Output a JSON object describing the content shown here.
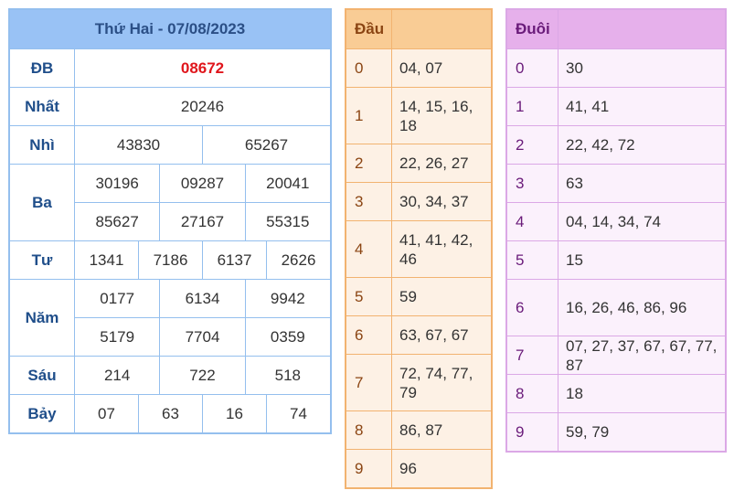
{
  "results": {
    "title": "Thứ Hai - 07/08/2023",
    "prizes": [
      {
        "label": "ĐB",
        "lines": [
          [
            "08672"
          ]
        ]
      },
      {
        "label": "Nhất",
        "lines": [
          [
            "20246"
          ]
        ]
      },
      {
        "label": "Nhì",
        "lines": [
          [
            "43830",
            "65267"
          ]
        ]
      },
      {
        "label": "Ba",
        "lines": [
          [
            "30196",
            "09287",
            "20041"
          ],
          [
            "85627",
            "27167",
            "55315"
          ]
        ]
      },
      {
        "label": "Tư",
        "lines": [
          [
            "1341",
            "7186",
            "6137",
            "2626"
          ]
        ]
      },
      {
        "label": "Năm",
        "lines": [
          [
            "0177",
            "6134",
            "9942"
          ],
          [
            "5179",
            "7704",
            "0359"
          ]
        ]
      },
      {
        "label": "Sáu",
        "lines": [
          [
            "214",
            "722",
            "518"
          ]
        ]
      },
      {
        "label": "Bảy",
        "lines": [
          [
            "07",
            "63",
            "16",
            "74"
          ]
        ]
      }
    ]
  },
  "dau": {
    "header": "Đầu",
    "rows": [
      {
        "key": "0",
        "values": "04, 07"
      },
      {
        "key": "1",
        "values": "14, 15, 16, 18"
      },
      {
        "key": "2",
        "values": "22, 26, 27"
      },
      {
        "key": "3",
        "values": "30, 34, 37"
      },
      {
        "key": "4",
        "values": "41, 41, 42, 46"
      },
      {
        "key": "5",
        "values": "59"
      },
      {
        "key": "6",
        "values": "63, 67, 67"
      },
      {
        "key": "7",
        "values": "72, 74, 77, 79"
      },
      {
        "key": "8",
        "values": "86, 87"
      },
      {
        "key": "9",
        "values": "96"
      }
    ]
  },
  "duoi": {
    "header": "Đuôi",
    "rows": [
      {
        "key": "0",
        "values": "30"
      },
      {
        "key": "1",
        "values": "41, 41"
      },
      {
        "key": "2",
        "values": "22, 42, 72"
      },
      {
        "key": "3",
        "values": "63"
      },
      {
        "key": "4",
        "values": "04, 14, 34, 74"
      },
      {
        "key": "5",
        "values": "15"
      },
      {
        "key": "6",
        "values": "16, 26, 46, 86, 96"
      },
      {
        "key": "7",
        "values": "07, 27, 37, 67, 67, 77, 87"
      },
      {
        "key": "8",
        "values": "18"
      },
      {
        "key": "9",
        "values": "59, 79"
      }
    ]
  },
  "colors": {
    "special_prize": "#e0161c",
    "results_header": "#99c2f5",
    "dau_header": "#f9cc95",
    "duoi_header": "#e6b0eb"
  }
}
